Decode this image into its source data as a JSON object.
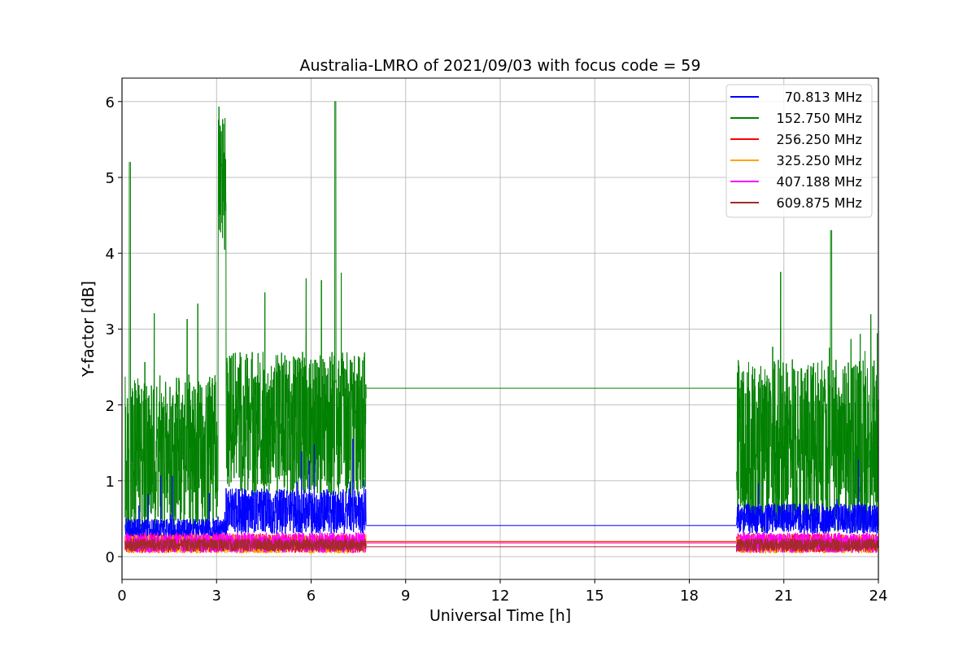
{
  "chart": {
    "title": "Australia-LMRO of 2021/09/03 with focus code = 59",
    "xlabel": "Universal Time [h]",
    "ylabel": "Y-factor [dB]",
    "xtick_labels": [
      "0",
      "3",
      "6",
      "9",
      "12",
      "15",
      "18",
      "21",
      "24"
    ],
    "ytick_labels": [
      "6",
      "5",
      "4",
      "3",
      "2",
      "1",
      "0"
    ],
    "legend": [
      {
        "label": "70.813 MHz",
        "color": "#0000ff"
      },
      {
        "label": "152.750 MHz",
        "color": "#008000"
      },
      {
        "label": "256.250 MHz",
        "color": "#ff0000"
      },
      {
        "label": "325.250 MHz",
        "color": "#ffa500"
      },
      {
        "label": "407.188 MHz",
        "color": "#ff00ff"
      },
      {
        "label": "609.875 MHz",
        "color": "#a52a2a"
      }
    ]
  }
}
